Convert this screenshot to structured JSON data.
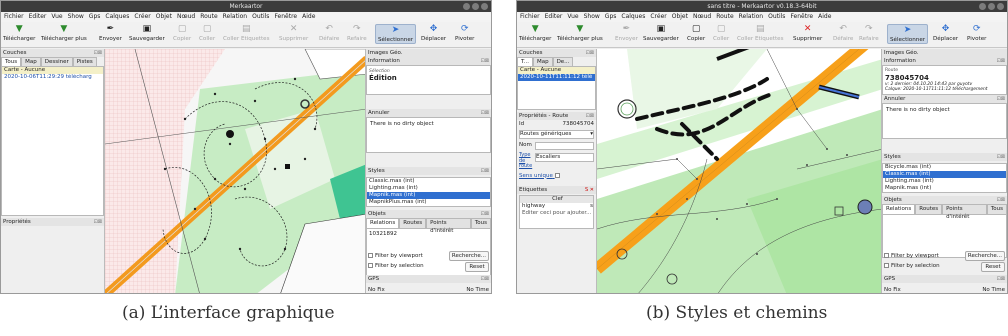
{
  "figure_a": {
    "window_title": "Merkaartor",
    "menu": [
      "Fichier",
      "Editer",
      "Vue",
      "Show",
      "Gps",
      "Calques",
      "Créer",
      "Objet",
      "Nœud",
      "Route",
      "Relation",
      "Outils",
      "Fenêtre",
      "Aide"
    ],
    "toolbar": [
      "Télécharger",
      "Télécharger plus",
      "Envoyer",
      "Sauvegarder",
      "Copier",
      "Coller",
      "Coller Etiquettes",
      "Supprimer",
      "Défaire",
      "Refaire",
      "Sélectionner",
      "Déplacer",
      "Pivoter"
    ],
    "layers_title": "Couches",
    "layer_tabs": [
      "Tous",
      "Map",
      "Dessiner",
      "Pistes"
    ],
    "layers": [
      "Carte - Aucune",
      "2020-10-06T11:29:29 télécharg"
    ],
    "properties_title": "Propriétés",
    "images_geo": "Images Géo.",
    "information": "Information",
    "info_small": "Sélection",
    "info_bold": "Édition",
    "undo_title": "Annuler",
    "dirty": "There is no dirty object",
    "styles_title": "Styles",
    "styles": [
      "Classic.mas (int)",
      "Lighting.mas (int)",
      "Mapnik.mas (int)",
      "MapnikPlus.mas (int)"
    ],
    "objects_title": "Objets",
    "object_tabs": [
      "Relations",
      "Routes",
      "Points d'intérêt",
      "Tous"
    ],
    "object_value": "10321892",
    "filter_viewport": "Filter by viewport",
    "filter_selection": "Filter by selection",
    "search_btn": "Recherche...",
    "reset_btn": "Reset",
    "gps_title": "GPS",
    "gps_fix": "No Fix",
    "gps_time": "No Time"
  },
  "figure_b": {
    "window_title": "sans titre - Merkaartor v0.18.3-64bit",
    "menu": [
      "Fichier",
      "Editer",
      "Vue",
      "Show",
      "Gps",
      "Calques",
      "Créer",
      "Objet",
      "Nœud",
      "Route",
      "Relation",
      "Outils",
      "Fenêtre",
      "Aide"
    ],
    "toolbar": [
      "Télécharger",
      "Télécharger plus",
      "Envoyer",
      "Sauvegarder",
      "Copier",
      "Coller",
      "Coller Etiquettes",
      "Supprimer",
      "Défaire",
      "Refaire",
      "Sélectionner",
      "Déplacer",
      "Pivoter"
    ],
    "layers_title": "Couches",
    "layer_tabs": [
      "T...",
      "Map",
      "De..."
    ],
    "layers": [
      "Carte - Aucune",
      "2020-10-11T11:11:12 télé"
    ],
    "props_title": "Propriétés - Route",
    "id_label": "Id",
    "id_value": "738045704",
    "routes_select": "Routes génériques",
    "nom_label": "Nom",
    "type_label": "Type de route",
    "type_value": "Escaliers",
    "sens": "Sens unique",
    "labels_title": "Etiquettes",
    "clef": "Clef",
    "tag_key": "highway",
    "tag_value": "s",
    "edit_hint": "Editer ceci pour ajouter...",
    "images_geo": "Images Géo.",
    "information": "Information",
    "route_label": "Route",
    "route_id": "738045704",
    "info_line1": "v: 2 dernier: 04.10.20 14:43 par guyotv",
    "info_line2": "Calque: 2020-10-11T11:11:12 téléchargement",
    "undo_title": "Annuler",
    "dirty": "There is no dirty object",
    "styles_title": "Styles",
    "styles": [
      "Bicycle.mas (int)",
      "Classic.mas (int)",
      "Lighting.mas (int)",
      "Mapnik.mas (int)"
    ],
    "objects_title": "Objets",
    "object_tabs": [
      "Relations",
      "Routes",
      "Points d'intérêt",
      "Tous"
    ],
    "filter_viewport": "Filter by viewport",
    "filter_selection": "Filter by selection",
    "search_btn": "Recherche...",
    "reset_btn": "Reset",
    "gps_title": "GPS",
    "gps_fix": "No Fix",
    "gps_time": "No Time"
  },
  "captions": {
    "a": "(a) L’interface graphique",
    "b": "(b) Styles et chemins"
  }
}
